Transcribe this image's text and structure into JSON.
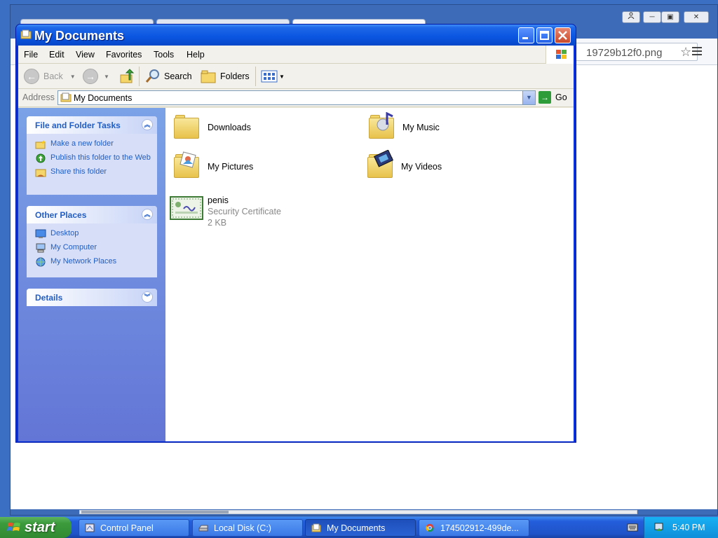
{
  "chrome": {
    "omnibox_text": "19729b12f0.png",
    "star_icon": "star-icon",
    "menu_icon": "hamburger-icon"
  },
  "window": {
    "title": "My Documents",
    "minimize": "_",
    "maximize": "□",
    "close": "✕"
  },
  "menu": [
    "File",
    "Edit",
    "View",
    "Favorites",
    "Tools",
    "Help"
  ],
  "toolbar": {
    "back_label": "Back",
    "search_label": "Search",
    "folders_label": "Folders"
  },
  "address": {
    "label": "Address",
    "value": "My Documents",
    "go_label": "Go"
  },
  "panels": {
    "file_tasks": {
      "title": "File and Folder Tasks",
      "items": [
        "Make a new folder",
        "Publish this folder to the Web",
        "Share this folder"
      ]
    },
    "other_places": {
      "title": "Other Places",
      "items": [
        "Desktop",
        "My Computer",
        "My Network Places"
      ]
    },
    "details": {
      "title": "Details"
    }
  },
  "files": [
    {
      "name": "Downloads"
    },
    {
      "name": "My Music"
    },
    {
      "name": "My Pictures"
    },
    {
      "name": "My Videos"
    },
    {
      "name": "penis",
      "type": "Security Certificate",
      "size": "2 KB"
    }
  ],
  "taskbar": {
    "start_label": "start",
    "tasks": [
      "Control Panel",
      "Local Disk (C:)",
      "My Documents",
      "174502912-499de..."
    ],
    "clock": "5:40 PM"
  },
  "colors": {
    "xp_blue": "#0a55e0",
    "task_link": "#215dc6",
    "start_green": "#3c9a3c"
  }
}
